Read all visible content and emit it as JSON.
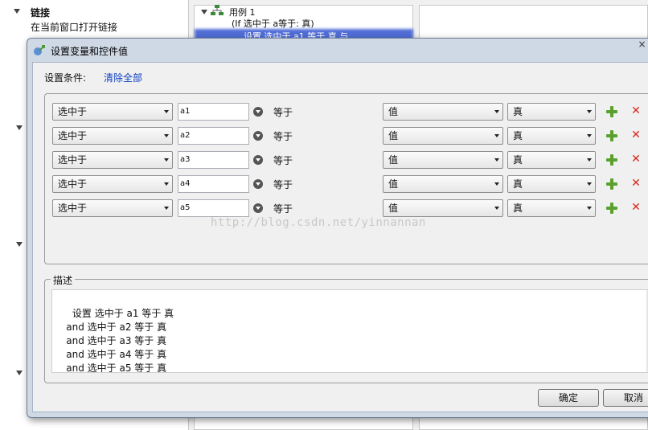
{
  "background": {
    "tree_title": "链接",
    "tree_item": "在当前窗口打开链接",
    "case_label": "用例 1",
    "case_condition": "(If 选中于 a等于: 真)",
    "selected_action": "设置 选中于 a1 等于 真 与"
  },
  "dialog": {
    "title": "设置变量和控件值",
    "close_glyph": "×",
    "condition_label": "设置条件:",
    "clear_all": "清除全部",
    "rows": [
      {
        "kind": "选中于",
        "target": "a1",
        "operator": "等于",
        "value_type": "值",
        "value": "真"
      },
      {
        "kind": "选中于",
        "target": "a2",
        "operator": "等于",
        "value_type": "值",
        "value": "真"
      },
      {
        "kind": "选中于",
        "target": "a3",
        "operator": "等于",
        "value_type": "值",
        "value": "真"
      },
      {
        "kind": "选中于",
        "target": "a4",
        "operator": "等于",
        "value_type": "值",
        "value": "真"
      },
      {
        "kind": "选中于",
        "target": "a5",
        "operator": "等于",
        "value_type": "值",
        "value": "真"
      }
    ],
    "description_label": "描述",
    "description_text": "设置 选中于 a1 等于 真\n    and 选中于 a2 等于 真\n    and 选中于 a3 等于 真\n    and 选中于 a4 等于 真\n    and 选中于 a5 等于 真",
    "ok_label": "确定",
    "cancel_label": "取消"
  },
  "watermark": "http://blog.csdn.net/yinnannan",
  "colors": {
    "selection": "#3f5fd2",
    "link": "#0b3ec6",
    "add": "#5aa02c",
    "delete": "#d42a20"
  }
}
